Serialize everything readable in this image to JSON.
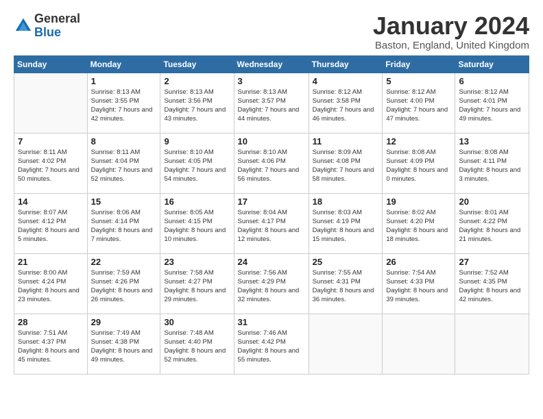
{
  "logo": {
    "general": "General",
    "blue": "Blue"
  },
  "title": "January 2024",
  "subtitle": "Baston, England, United Kingdom",
  "days_of_week": [
    "Sunday",
    "Monday",
    "Tuesday",
    "Wednesday",
    "Thursday",
    "Friday",
    "Saturday"
  ],
  "weeks": [
    [
      {
        "day": "",
        "sunrise": "",
        "sunset": "",
        "daylight": ""
      },
      {
        "day": "1",
        "sunrise": "Sunrise: 8:13 AM",
        "sunset": "Sunset: 3:55 PM",
        "daylight": "Daylight: 7 hours and 42 minutes."
      },
      {
        "day": "2",
        "sunrise": "Sunrise: 8:13 AM",
        "sunset": "Sunset: 3:56 PM",
        "daylight": "Daylight: 7 hours and 43 minutes."
      },
      {
        "day": "3",
        "sunrise": "Sunrise: 8:13 AM",
        "sunset": "Sunset: 3:57 PM",
        "daylight": "Daylight: 7 hours and 44 minutes."
      },
      {
        "day": "4",
        "sunrise": "Sunrise: 8:12 AM",
        "sunset": "Sunset: 3:58 PM",
        "daylight": "Daylight: 7 hours and 46 minutes."
      },
      {
        "day": "5",
        "sunrise": "Sunrise: 8:12 AM",
        "sunset": "Sunset: 4:00 PM",
        "daylight": "Daylight: 7 hours and 47 minutes."
      },
      {
        "day": "6",
        "sunrise": "Sunrise: 8:12 AM",
        "sunset": "Sunset: 4:01 PM",
        "daylight": "Daylight: 7 hours and 49 minutes."
      }
    ],
    [
      {
        "day": "7",
        "sunrise": "Sunrise: 8:11 AM",
        "sunset": "Sunset: 4:02 PM",
        "daylight": "Daylight: 7 hours and 50 minutes."
      },
      {
        "day": "8",
        "sunrise": "Sunrise: 8:11 AM",
        "sunset": "Sunset: 4:04 PM",
        "daylight": "Daylight: 7 hours and 52 minutes."
      },
      {
        "day": "9",
        "sunrise": "Sunrise: 8:10 AM",
        "sunset": "Sunset: 4:05 PM",
        "daylight": "Daylight: 7 hours and 54 minutes."
      },
      {
        "day": "10",
        "sunrise": "Sunrise: 8:10 AM",
        "sunset": "Sunset: 4:06 PM",
        "daylight": "Daylight: 7 hours and 56 minutes."
      },
      {
        "day": "11",
        "sunrise": "Sunrise: 8:09 AM",
        "sunset": "Sunset: 4:08 PM",
        "daylight": "Daylight: 7 hours and 58 minutes."
      },
      {
        "day": "12",
        "sunrise": "Sunrise: 8:08 AM",
        "sunset": "Sunset: 4:09 PM",
        "daylight": "Daylight: 8 hours and 0 minutes."
      },
      {
        "day": "13",
        "sunrise": "Sunrise: 8:08 AM",
        "sunset": "Sunset: 4:11 PM",
        "daylight": "Daylight: 8 hours and 3 minutes."
      }
    ],
    [
      {
        "day": "14",
        "sunrise": "Sunrise: 8:07 AM",
        "sunset": "Sunset: 4:12 PM",
        "daylight": "Daylight: 8 hours and 5 minutes."
      },
      {
        "day": "15",
        "sunrise": "Sunrise: 8:06 AM",
        "sunset": "Sunset: 4:14 PM",
        "daylight": "Daylight: 8 hours and 7 minutes."
      },
      {
        "day": "16",
        "sunrise": "Sunrise: 8:05 AM",
        "sunset": "Sunset: 4:15 PM",
        "daylight": "Daylight: 8 hours and 10 minutes."
      },
      {
        "day": "17",
        "sunrise": "Sunrise: 8:04 AM",
        "sunset": "Sunset: 4:17 PM",
        "daylight": "Daylight: 8 hours and 12 minutes."
      },
      {
        "day": "18",
        "sunrise": "Sunrise: 8:03 AM",
        "sunset": "Sunset: 4:19 PM",
        "daylight": "Daylight: 8 hours and 15 minutes."
      },
      {
        "day": "19",
        "sunrise": "Sunrise: 8:02 AM",
        "sunset": "Sunset: 4:20 PM",
        "daylight": "Daylight: 8 hours and 18 minutes."
      },
      {
        "day": "20",
        "sunrise": "Sunrise: 8:01 AM",
        "sunset": "Sunset: 4:22 PM",
        "daylight": "Daylight: 8 hours and 21 minutes."
      }
    ],
    [
      {
        "day": "21",
        "sunrise": "Sunrise: 8:00 AM",
        "sunset": "Sunset: 4:24 PM",
        "daylight": "Daylight: 8 hours and 23 minutes."
      },
      {
        "day": "22",
        "sunrise": "Sunrise: 7:59 AM",
        "sunset": "Sunset: 4:26 PM",
        "daylight": "Daylight: 8 hours and 26 minutes."
      },
      {
        "day": "23",
        "sunrise": "Sunrise: 7:58 AM",
        "sunset": "Sunset: 4:27 PM",
        "daylight": "Daylight: 8 hours and 29 minutes."
      },
      {
        "day": "24",
        "sunrise": "Sunrise: 7:56 AM",
        "sunset": "Sunset: 4:29 PM",
        "daylight": "Daylight: 8 hours and 32 minutes."
      },
      {
        "day": "25",
        "sunrise": "Sunrise: 7:55 AM",
        "sunset": "Sunset: 4:31 PM",
        "daylight": "Daylight: 8 hours and 36 minutes."
      },
      {
        "day": "26",
        "sunrise": "Sunrise: 7:54 AM",
        "sunset": "Sunset: 4:33 PM",
        "daylight": "Daylight: 8 hours and 39 minutes."
      },
      {
        "day": "27",
        "sunrise": "Sunrise: 7:52 AM",
        "sunset": "Sunset: 4:35 PM",
        "daylight": "Daylight: 8 hours and 42 minutes."
      }
    ],
    [
      {
        "day": "28",
        "sunrise": "Sunrise: 7:51 AM",
        "sunset": "Sunset: 4:37 PM",
        "daylight": "Daylight: 8 hours and 45 minutes."
      },
      {
        "day": "29",
        "sunrise": "Sunrise: 7:49 AM",
        "sunset": "Sunset: 4:38 PM",
        "daylight": "Daylight: 8 hours and 49 minutes."
      },
      {
        "day": "30",
        "sunrise": "Sunrise: 7:48 AM",
        "sunset": "Sunset: 4:40 PM",
        "daylight": "Daylight: 8 hours and 52 minutes."
      },
      {
        "day": "31",
        "sunrise": "Sunrise: 7:46 AM",
        "sunset": "Sunset: 4:42 PM",
        "daylight": "Daylight: 8 hours and 55 minutes."
      },
      {
        "day": "",
        "sunrise": "",
        "sunset": "",
        "daylight": ""
      },
      {
        "day": "",
        "sunrise": "",
        "sunset": "",
        "daylight": ""
      },
      {
        "day": "",
        "sunrise": "",
        "sunset": "",
        "daylight": ""
      }
    ]
  ]
}
